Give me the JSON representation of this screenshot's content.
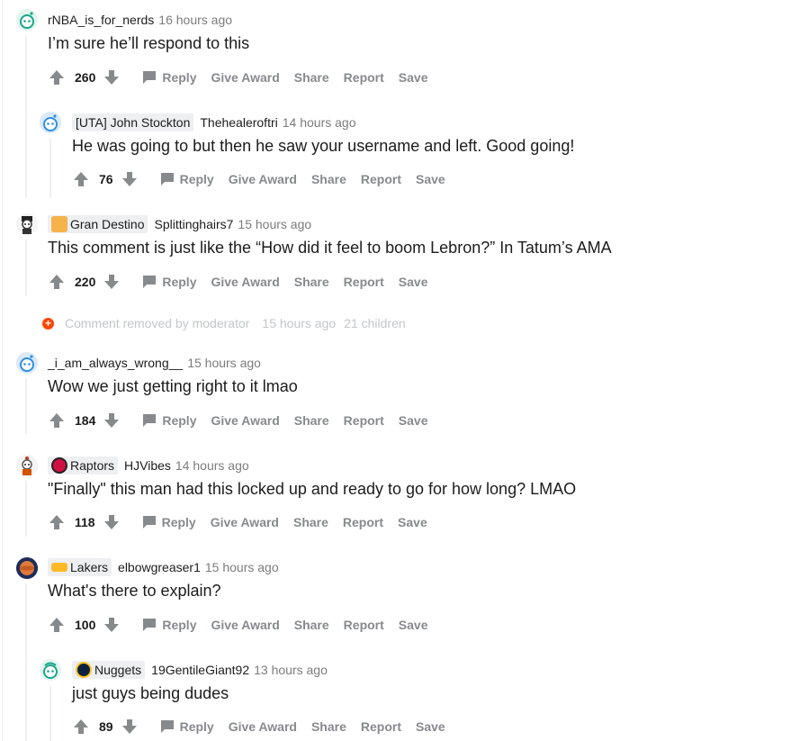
{
  "comments": [
    {
      "author": "rNBA_is_for_nerds",
      "time": "16 hours ago",
      "body": "I’m sure he’ll respond to this",
      "score": "260",
      "flair": ""
    },
    {
      "author": "Thehealeroftri",
      "time": "14 hours ago",
      "body": "He was going to but then he saw your username and left. Good going!",
      "score": "76",
      "flair": "[UTA] John Stockton"
    },
    {
      "author": "Splittinghairs7",
      "time": "15 hours ago",
      "body": "This comment is just like the “How did it feel to boom Lebron?” In Tatum’s AMA",
      "score": "220",
      "flair": "Gran Destino"
    },
    {
      "author": "_i_am_always_wrong__",
      "time": "15 hours ago",
      "body": "Wow we just getting right to it lmao",
      "score": "184",
      "flair": ""
    },
    {
      "author": "HJVibes",
      "time": "14 hours ago",
      "body": "\"Finally\" this man had this locked up and ready to go for how long? LMAO",
      "score": "118",
      "flair": "Raptors"
    },
    {
      "author": "elbowgreaser1",
      "time": "15 hours ago",
      "body": "What's there to explain?",
      "score": "100",
      "flair": "Lakers"
    },
    {
      "author": "19GentileGiant92",
      "time": "13 hours ago",
      "body": "just guys being dudes",
      "score": "89",
      "flair": "Nuggets"
    }
  ],
  "removed": {
    "text": "Comment removed by moderator",
    "time": "15 hours ago",
    "children": "21 children"
  },
  "actions": {
    "reply": "Reply",
    "give_award": "Give Award",
    "share": "Share",
    "report": "Report",
    "save": "Save"
  },
  "icons": {
    "upvote": "upvote-arrow-icon",
    "downvote": "downvote-arrow-icon",
    "reply": "speech-bubble-icon"
  },
  "colors": {
    "text": "#1c1c1c",
    "muted": "#7c7c7c",
    "action": "#878a8c",
    "flair_bg": "#edeff1",
    "removed_accent": "#ff4500"
  }
}
